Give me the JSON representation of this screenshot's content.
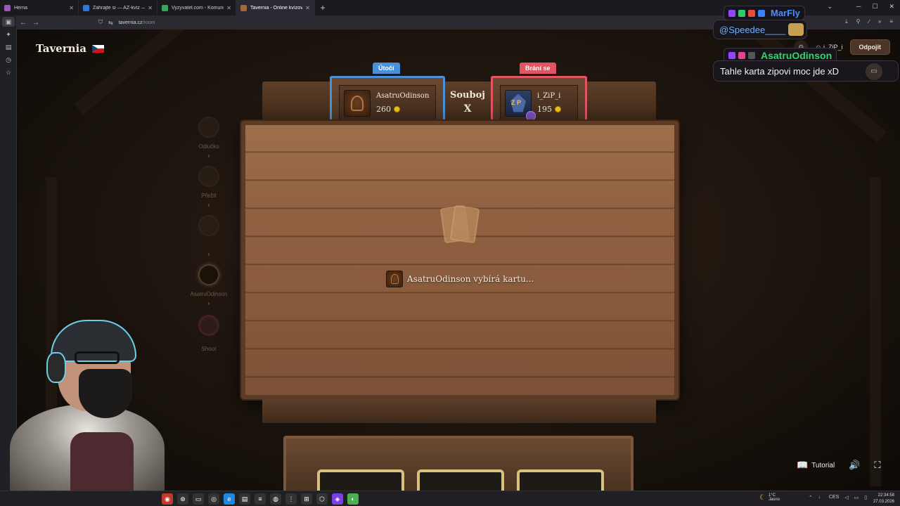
{
  "browser": {
    "tabs": [
      {
        "label": "Herna",
        "color": "#9b59b6",
        "active": false
      },
      {
        "label": "Zahrajte si — AZ-kvíz — Český",
        "color": "#2d7ad6",
        "active": false
      },
      {
        "label": "Vyzyvatel.com - Komunitní vědo",
        "color": "#3aa55c",
        "active": false
      },
      {
        "label": "Tavernia - Online kvízová h",
        "color": "#a06a3a",
        "active": true
      }
    ],
    "url_host": "tavernia.cz",
    "url_path": "/room"
  },
  "game": {
    "logo": "Tavernia",
    "disconnect_label": "Odpojit",
    "menu_user": "i_ZiP_i",
    "steps": [
      {
        "label": "Odlučko"
      },
      {
        "label": "Přežít"
      },
      {
        "label": ""
      },
      {
        "label": "AsatruOdinson"
      },
      {
        "label": "Shoot"
      }
    ],
    "attacker": {
      "role": "Útočí",
      "name": "AsatruOdinson",
      "score": "260"
    },
    "defender": {
      "role": "Brání se",
      "name": "i_ZiP_i",
      "score": "195"
    },
    "vs_label": "Souboj",
    "vs_x": "X",
    "status": {
      "player": "AsatruOdinson",
      "text": "vybírá kartu..."
    },
    "tutorial_label": "Tutorial"
  },
  "chat": {
    "messages": [
      {
        "name": "MarFly",
        "text": "@Speedee____"
      },
      {
        "name": "AsatruOdinson",
        "text": "Tahle karta zipovi moc jde xD"
      }
    ]
  },
  "taskbar": {
    "weather_temp": "1°C",
    "weather_desc": "Jasno",
    "lang": "CES",
    "time": "22:34:58",
    "date": "27.03.2026"
  }
}
